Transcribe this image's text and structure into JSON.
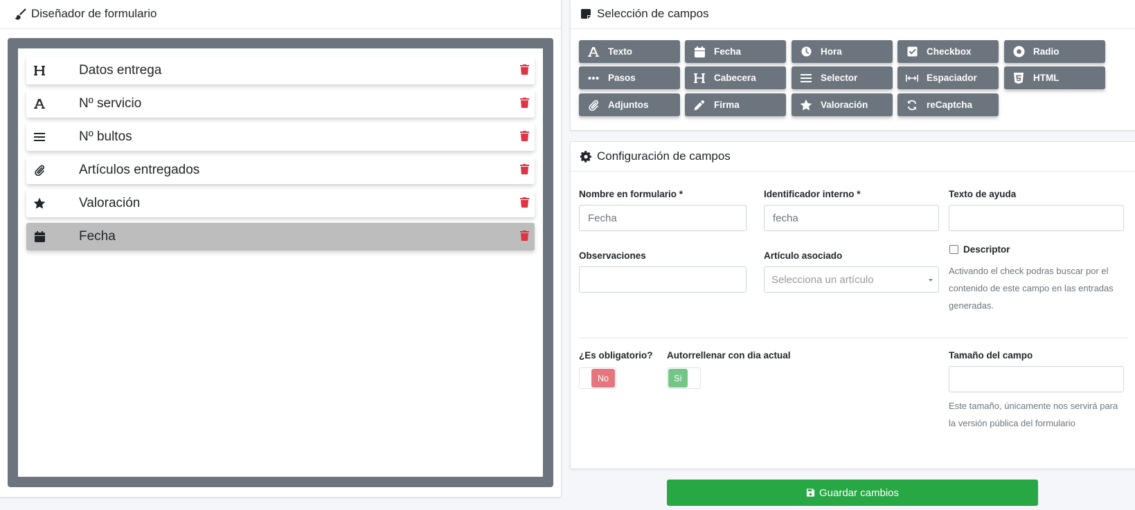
{
  "designer": {
    "title": "Diseñador de formulario",
    "fields": [
      {
        "icon": "heading-icon",
        "label": "Datos entrega",
        "selected": false
      },
      {
        "icon": "text-icon",
        "label": "Nº servicio",
        "selected": false
      },
      {
        "icon": "list-icon",
        "label": "Nº bultos",
        "selected": false
      },
      {
        "icon": "paperclip-icon",
        "label": "Artículos entregados",
        "selected": false
      },
      {
        "icon": "star-icon",
        "label": "Valoración",
        "selected": false
      },
      {
        "icon": "calendar-icon",
        "label": "Fecha",
        "selected": true
      }
    ]
  },
  "selection": {
    "title": "Selección de campos",
    "buttons": [
      {
        "icon": "text-icon",
        "label": "Texto"
      },
      {
        "icon": "calendar-icon",
        "label": "Fecha"
      },
      {
        "icon": "clock-icon",
        "label": "Hora"
      },
      {
        "icon": "checkbox-icon",
        "label": "Checkbox"
      },
      {
        "icon": "radio-icon",
        "label": "Radio"
      },
      {
        "icon": "ellipsis-icon",
        "label": "Pasos"
      },
      {
        "icon": "heading-icon",
        "label": "Cabecera"
      },
      {
        "icon": "list-icon",
        "label": "Selector"
      },
      {
        "icon": "arrows-h-icon",
        "label": "Espaciador"
      },
      {
        "icon": "html5-icon",
        "label": "HTML"
      },
      {
        "icon": "paperclip-icon",
        "label": "Adjuntos"
      },
      {
        "icon": "pencil-icon",
        "label": "Firma"
      },
      {
        "icon": "star-icon",
        "label": "Valoración"
      },
      {
        "icon": "sync-icon",
        "label": "reCaptcha"
      }
    ]
  },
  "config": {
    "title": "Configuración de campos",
    "name_label": "Nombre en formulario *",
    "name_value": "Fecha",
    "id_label": "Identificador interno *",
    "id_value": "fecha",
    "help_label": "Texto de ayuda",
    "help_value": "",
    "obs_label": "Observaciones",
    "obs_value": "",
    "article_label": "Artículo asociado",
    "article_placeholder": "Selecciona un artículo",
    "descriptor_label": "Descriptor",
    "descriptor_checked": false,
    "descriptor_help": [
      "Activando el check podras buscar por el",
      "contenido de este campo en las entradas",
      "generadas."
    ],
    "required_label": "¿Es obligatorio?",
    "required_value": "No",
    "autofill_label": "Autorrellenar con dia actual",
    "autofill_value": "Sí",
    "size_label": "Tamaño del campo",
    "size_value": "",
    "size_help": [
      "Este tamaño, únicamente nos servirá para",
      "la versión pública del formulario"
    ]
  },
  "save_label": "Guardar cambios",
  "colors": {
    "primary_btn": "#6c757d",
    "save": "#28a745",
    "trash": "#dc3545",
    "toggle_no": "#e6767e",
    "toggle_yes": "#74c687"
  }
}
